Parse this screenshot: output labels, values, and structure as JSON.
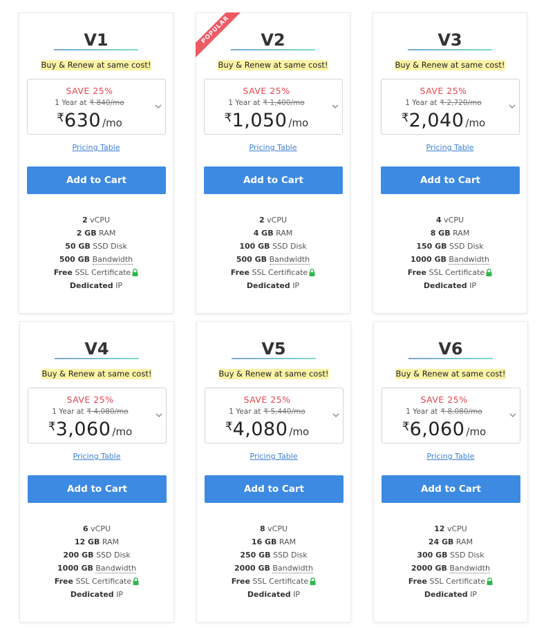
{
  "plans": [
    {
      "name": "V1",
      "popular": false,
      "tagline": "Buy & Renew at same cost!",
      "save": "SAVE 25%",
      "term": "1 Year at",
      "old_price": "₹ 840/mo",
      "currency": "₹",
      "price": "630",
      "per": "/mo",
      "pricing_link": "Pricing Table",
      "cart_label": "Add to Cart",
      "vcpu": "2",
      "vcpu_label": "vCPU",
      "ram": "2 GB",
      "ram_label": "RAM",
      "disk": "50 GB",
      "disk_label": "SSD Disk",
      "bw": "500 GB",
      "bw_label": "Bandwidth",
      "ssl": "Free",
      "ssl_label": "SSL Certificate",
      "ip": "Dedicated",
      "ip_label": "IP"
    },
    {
      "name": "V2",
      "popular": true,
      "ribbon": "POPULAR",
      "tagline": "Buy & Renew at same cost!",
      "save": "SAVE 25%",
      "term": "1 Year at",
      "old_price": "₹ 1,400/mo",
      "currency": "₹",
      "price": "1,050",
      "per": "/mo",
      "pricing_link": "Pricing Table",
      "cart_label": "Add to Cart",
      "vcpu": "2",
      "vcpu_label": "vCPU",
      "ram": "4 GB",
      "ram_label": "RAM",
      "disk": "100 GB",
      "disk_label": "SSD Disk",
      "bw": "500 GB",
      "bw_label": "Bandwidth",
      "ssl": "Free",
      "ssl_label": "SSL Certificate",
      "ip": "Dedicated",
      "ip_label": "IP"
    },
    {
      "name": "V3",
      "popular": false,
      "tagline": "Buy & Renew at same cost!",
      "save": "SAVE 25%",
      "term": "1 Year at",
      "old_price": "₹ 2,720/mo",
      "currency": "₹",
      "price": "2,040",
      "per": "/mo",
      "pricing_link": "Pricing Table",
      "cart_label": "Add to Cart",
      "vcpu": "4",
      "vcpu_label": "vCPU",
      "ram": "8 GB",
      "ram_label": "RAM",
      "disk": "150 GB",
      "disk_label": "SSD Disk",
      "bw": "1000 GB",
      "bw_label": "Bandwidth",
      "ssl": "Free",
      "ssl_label": "SSL Certificate",
      "ip": "Dedicated",
      "ip_label": "IP"
    },
    {
      "name": "V4",
      "popular": false,
      "tagline": "Buy & Renew at same cost!",
      "save": "SAVE 25%",
      "term": "1 Year at",
      "old_price": "₹ 4,080/mo",
      "currency": "₹",
      "price": "3,060",
      "per": "/mo",
      "pricing_link": "Pricing Table",
      "cart_label": "Add to Cart",
      "vcpu": "6",
      "vcpu_label": "vCPU",
      "ram": "12 GB",
      "ram_label": "RAM",
      "disk": "200 GB",
      "disk_label": "SSD Disk",
      "bw": "1000 GB",
      "bw_label": "Bandwidth",
      "ssl": "Free",
      "ssl_label": "SSL Certificate",
      "ip": "Dedicated",
      "ip_label": "IP"
    },
    {
      "name": "V5",
      "popular": false,
      "tagline": "Buy & Renew at same cost!",
      "save": "SAVE 25%",
      "term": "1 Year at",
      "old_price": "₹ 5,440/mo",
      "currency": "₹",
      "price": "4,080",
      "per": "/mo",
      "pricing_link": "Pricing Table",
      "cart_label": "Add to Cart",
      "vcpu": "8",
      "vcpu_label": "vCPU",
      "ram": "16 GB",
      "ram_label": "RAM",
      "disk": "250 GB",
      "disk_label": "SSD Disk",
      "bw": "2000 GB",
      "bw_label": "Bandwidth",
      "ssl": "Free",
      "ssl_label": "SSL Certificate",
      "ip": "Dedicated",
      "ip_label": "IP"
    },
    {
      "name": "V6",
      "popular": false,
      "tagline": "Buy & Renew at same cost!",
      "save": "SAVE 25%",
      "term": "1 Year at",
      "old_price": "₹ 8,080/mo",
      "currency": "₹",
      "price": "6,060",
      "per": "/mo",
      "pricing_link": "Pricing Table",
      "cart_label": "Add to Cart",
      "vcpu": "12",
      "vcpu_label": "vCPU",
      "ram": "24 GB",
      "ram_label": "RAM",
      "disk": "300 GB",
      "disk_label": "SSD Disk",
      "bw": "2000 GB",
      "bw_label": "Bandwidth",
      "ssl": "Free",
      "ssl_label": "SSL Certificate",
      "ip": "Dedicated",
      "ip_label": "IP"
    }
  ],
  "icons": {
    "select": "chevron-down-icon",
    "ssl": "lock-icon"
  },
  "colors": {
    "accent": "#3d8ae2",
    "save": "#e2454d",
    "ribbon": "#ee5a64",
    "highlight": "#fbf3a5",
    "lock": "#2eb84b",
    "link": "#3a7fd6"
  }
}
